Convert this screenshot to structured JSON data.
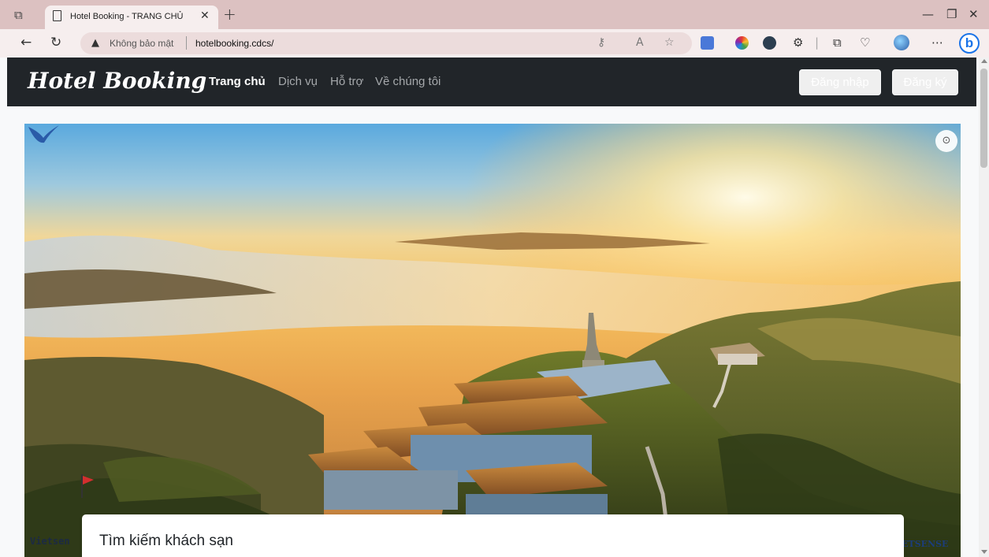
{
  "browser": {
    "tab_title": "Hotel Booking - TRANG CHỦ",
    "insecure_label": "Không bảo mật",
    "url": "hotelbooking.cdcs/"
  },
  "site": {
    "brand": "Hotel Booking",
    "nav": [
      {
        "label": "Trang chủ",
        "active": true
      },
      {
        "label": "Dịch vụ",
        "active": false
      },
      {
        "label": "Hỗ trợ",
        "active": false
      },
      {
        "label": "Về chúng tôi",
        "active": false
      }
    ],
    "login_label": "Đăng nhập",
    "register_label": "Đăng ký"
  },
  "hero": {
    "watermark_left": "Vietsen",
    "watermark_right": "IETSENSE"
  },
  "search": {
    "title": "Tìm kiếm khách sạn"
  },
  "colors": {
    "navbar": "#212529",
    "tabbar": "#dcc1c1"
  }
}
